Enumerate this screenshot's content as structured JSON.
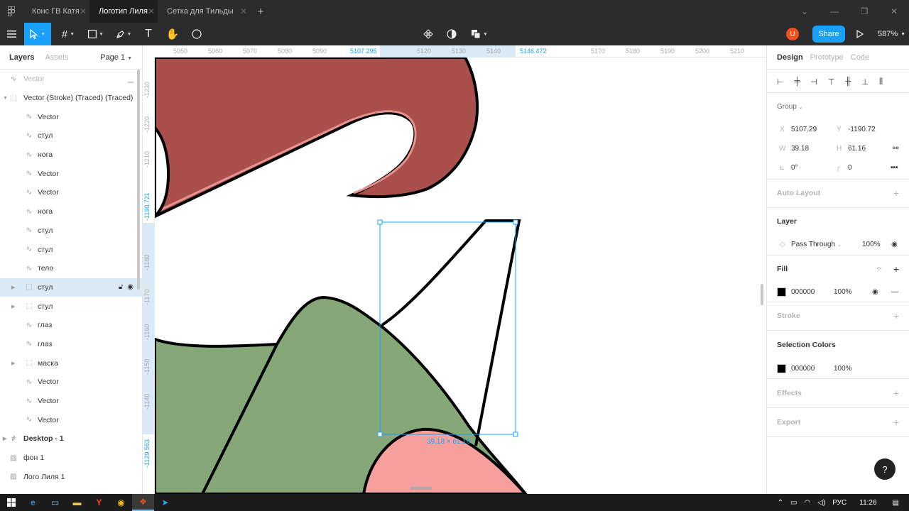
{
  "tabs": [
    {
      "label": "Конс ГВ Катя"
    },
    {
      "label": "Логотип Лиля"
    },
    {
      "label": "Сетка для Тильды"
    }
  ],
  "toolbar": {
    "share": "Share",
    "avatar": "U",
    "zoom": "587%"
  },
  "left_panel": {
    "tab_layers": "Layers",
    "tab_assets": "Assets",
    "page": "Page 1",
    "layers": [
      {
        "name": "Vector",
        "icon": "vector-icon"
      },
      {
        "name": "Vector (Stroke) (Traced) (Traced)",
        "icon": "group-icon"
      },
      {
        "name": "Vector",
        "icon": "vector-icon"
      },
      {
        "name": "стул",
        "icon": "vector-icon"
      },
      {
        "name": "нога",
        "icon": "vector-icon"
      },
      {
        "name": "Vector",
        "icon": "vector-icon"
      },
      {
        "name": "Vector",
        "icon": "vector-icon"
      },
      {
        "name": "нога",
        "icon": "vector-icon"
      },
      {
        "name": "стул",
        "icon": "vector-icon"
      },
      {
        "name": "стул",
        "icon": "vector-icon"
      },
      {
        "name": "тело",
        "icon": "vector-icon"
      },
      {
        "name": "стул",
        "icon": "group-icon"
      },
      {
        "name": "стул",
        "icon": "group-icon"
      },
      {
        "name": "глаз",
        "icon": "vector-icon"
      },
      {
        "name": "глаз",
        "icon": "vector-icon"
      },
      {
        "name": "маска",
        "icon": "group-icon"
      },
      {
        "name": "Vector",
        "icon": "vector-icon"
      },
      {
        "name": "Vector",
        "icon": "vector-icon"
      },
      {
        "name": "Vector",
        "icon": "vector-icon"
      },
      {
        "name": "Desktop - 1",
        "icon": "frame-icon"
      },
      {
        "name": "фон 1",
        "icon": "image-icon"
      },
      {
        "name": "Лого Лиля 1",
        "icon": "image-icon"
      }
    ]
  },
  "ruler": {
    "top_ticks": [
      "5050",
      "5060",
      "5070",
      "5080",
      "5090",
      "5120",
      "5130",
      "5140",
      "5170",
      "5180",
      "5190",
      "5200",
      "5210"
    ],
    "top_sel_start": "5107.295",
    "top_sel_end": "5146.472",
    "left_ticks": [
      "-1230",
      "-1220",
      "-1210",
      "-1180",
      "-1170",
      "-1160",
      "-1150",
      "-1140"
    ],
    "left_sel_start": "-1190.721",
    "left_sel_end": "-1129.563"
  },
  "canvas": {
    "dims_label": "39.18 × 61.16",
    "colors": {
      "red": "#a94f4c",
      "red_stroke": "#e69390",
      "green": "#86a878",
      "pink": "#f5a09c",
      "selection": "#18a0fb"
    }
  },
  "right_panel": {
    "tab_design": "Design",
    "tab_prototype": "Prototype",
    "tab_code": "Code",
    "group_label": "Group",
    "x_label": "X",
    "x_value": "5107.29",
    "y_label": "Y",
    "y_value": "-1190.72",
    "w_label": "W",
    "w_value": "39.18",
    "h_label": "H",
    "h_value": "61.16",
    "rotation": "0°",
    "radius": "0",
    "auto_layout": "Auto Layout",
    "layer_title": "Layer",
    "blend_mode": "Pass Through",
    "opacity": "100%",
    "fill_title": "Fill",
    "fill_hex": "000000",
    "fill_opacity": "100%",
    "stroke_title": "Stroke",
    "selection_colors_title": "Selection Colors",
    "sel_hex": "000000",
    "sel_opacity": "100%",
    "effects_title": "Effects",
    "export_title": "Export"
  },
  "taskbar": {
    "lang": "РУС",
    "time": "11:26"
  }
}
